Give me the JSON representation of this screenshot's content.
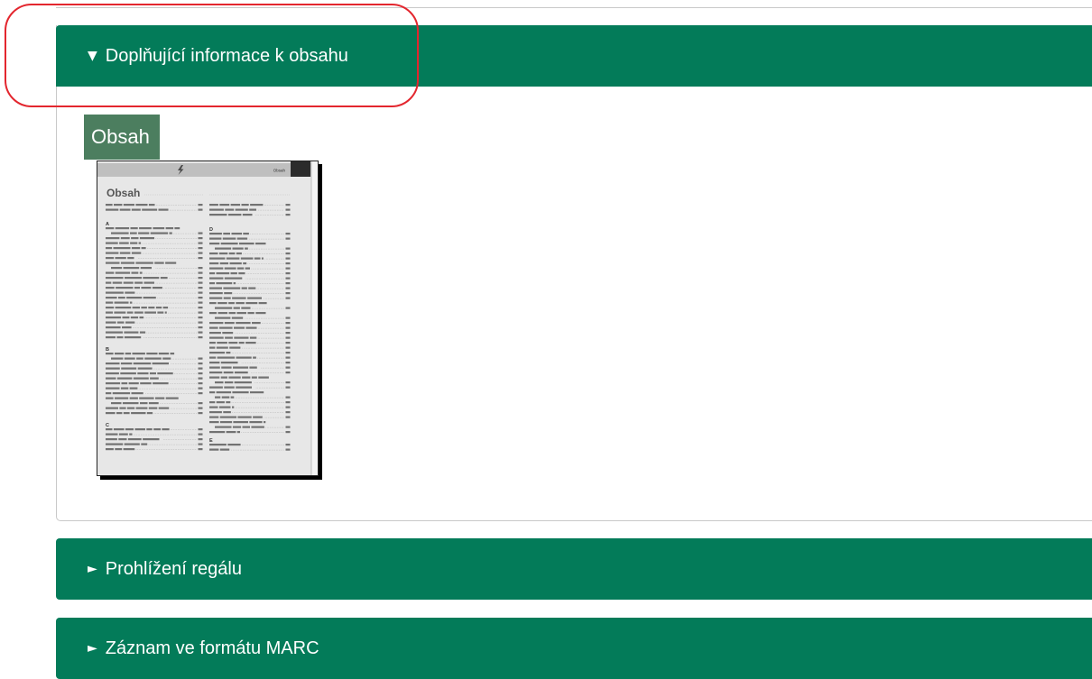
{
  "colors": {
    "section_header_bg": "#037b59",
    "section_header_text": "#ffffff",
    "content_label_bg": "#4c7e5f",
    "panel_border": "#c9c9c9",
    "annotation": "#e3262e"
  },
  "sections": [
    {
      "icon": "triangle-down-icon",
      "toggle": "▼",
      "title": "Doplňující informace k obsahu",
      "expanded": true
    },
    {
      "icon": "triangle-right-icon",
      "toggle": "►",
      "title": "Prohlížení regálu",
      "expanded": false
    },
    {
      "icon": "triangle-right-icon",
      "toggle": "►",
      "title": "Záznam ve formátu MARC",
      "expanded": false
    }
  ],
  "content": {
    "label": "Obsah",
    "thumbnail": {
      "page_header_label": "Obsah",
      "heading": "Obsah",
      "section_letters_left": [
        "A",
        "B",
        "C"
      ],
      "section_letters_right": [
        "D",
        "E"
      ]
    }
  }
}
